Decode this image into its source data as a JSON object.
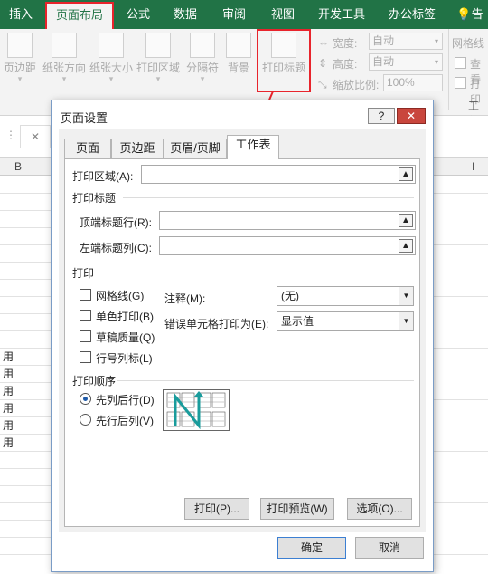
{
  "ribbon_tabs": [
    "插入",
    "页面布局",
    "公式",
    "数据",
    "审阅",
    "视图",
    "开发工具",
    "办公标签",
    "告诉"
  ],
  "ribbon_buttons": {
    "margins": "页边距",
    "orientation": "纸张方向",
    "size": "纸张大小",
    "print_area": "打印区域",
    "breaks": "分隔符",
    "background": "背景",
    "print_titles": "打印标题"
  },
  "scale": {
    "width_label": "宽度:",
    "width_value": "自动",
    "height_label": "高度:",
    "height_value": "自动",
    "scale_label": "缩放比例:",
    "scale_value": "100%"
  },
  "sheet_options": {
    "gridlines": "网格线",
    "view": "查看",
    "print": "打印",
    "group": "工作"
  },
  "formula_bar": {
    "cancel_icon": "✕"
  },
  "column_headers": [
    "B",
    "I"
  ],
  "cells": [
    "用",
    "用",
    "用",
    "用",
    "用",
    "用"
  ],
  "dialog": {
    "title": "页面设置",
    "help": "?",
    "close": "✕",
    "tabs": [
      "页面",
      "页边距",
      "页眉/页脚",
      "工作表"
    ],
    "print_area_label": "打印区域(A):",
    "print_titles_section": "打印标题",
    "rows_repeat_label": "顶端标题行(R):",
    "cols_repeat_label": "左端标题列(C):",
    "print_section": "打印",
    "gridlines_label": "网格线(G)",
    "bw_label": "单色打印(B)",
    "draft_label": "草稿质量(Q)",
    "headings_label": "行号列标(L)",
    "comments_label": "注释(M):",
    "comments_value": "(无)",
    "errors_label": "错误单元格打印为(E):",
    "errors_value": "显示值",
    "order_section": "打印顺序",
    "down_then_over": "先列后行(D)",
    "over_then_down": "先行后列(V)",
    "print_btn": "打印(P)...",
    "preview_btn": "打印预览(W)",
    "options_btn": "选项(O)...",
    "ok_btn": "确定",
    "cancel_btn": "取消"
  },
  "colors": {
    "excel_green": "#217346",
    "highlight_red": "#e8242c",
    "radio_blue": "#1e5aa8",
    "teal_arrow": "#1a9c9c"
  }
}
